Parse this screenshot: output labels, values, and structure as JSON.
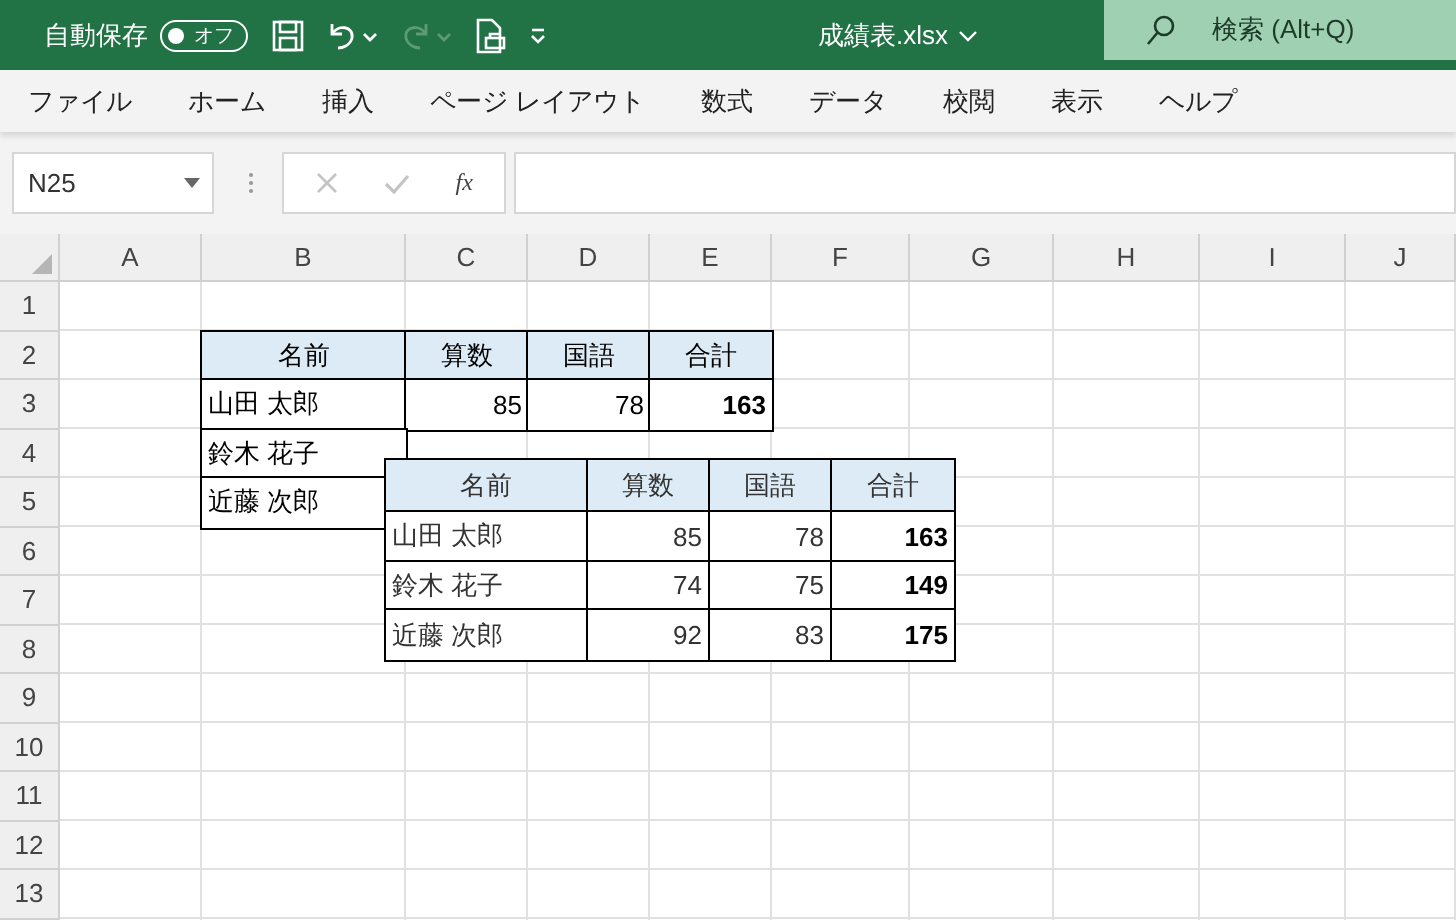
{
  "title_bar": {
    "autosave_label": "自動保存",
    "autosave_on": false,
    "autosave_state": "オフ",
    "filename": "成績表.xlsx",
    "search_placeholder": "検索 (Alt+Q)"
  },
  "quick_access": [
    {
      "kind": "save",
      "disabled": false
    },
    {
      "kind": "undo",
      "disabled": false
    },
    {
      "kind": "redo",
      "disabled": true
    },
    {
      "kind": "preview",
      "disabled": false
    },
    {
      "kind": "customize",
      "disabled": false
    }
  ],
  "menu": [
    {
      "label": "ファイル"
    },
    {
      "label": "ホーム"
    },
    {
      "label": "挿入"
    },
    {
      "label": "ページ レイアウト"
    },
    {
      "label": "数式"
    },
    {
      "label": "データ"
    },
    {
      "label": "校閲"
    },
    {
      "label": "表示"
    },
    {
      "label": "ヘルプ"
    }
  ],
  "formula_bar": {
    "name_box": "N25",
    "cancel_disabled": true,
    "enter_disabled": true,
    "fx": "fx"
  },
  "sheet": {
    "columns": [
      "A",
      "B",
      "C",
      "D",
      "E",
      "F",
      "G",
      "H",
      "I",
      "J"
    ],
    "rows": [
      "1",
      "2",
      "3",
      "4",
      "5",
      "6",
      "7",
      "8",
      "9",
      "10",
      "11",
      "12",
      "13"
    ],
    "table": {
      "header": [
        "名前",
        "算数",
        "国語",
        "合計"
      ],
      "rows": [
        [
          "山田 太郎",
          "85",
          "78",
          "163"
        ],
        [
          "鈴木 花子"
        ],
        [
          "近藤 次郎"
        ]
      ]
    }
  },
  "linked_picture": {
    "header": [
      "名前",
      "算数",
      "国語",
      "合計"
    ],
    "rows": [
      [
        "山田 太郎",
        "85",
        "78",
        "163"
      ],
      [
        "鈴木 花子",
        "74",
        "75",
        "149"
      ],
      [
        "近藤 次郎",
        "92",
        "83",
        "175"
      ]
    ]
  }
}
